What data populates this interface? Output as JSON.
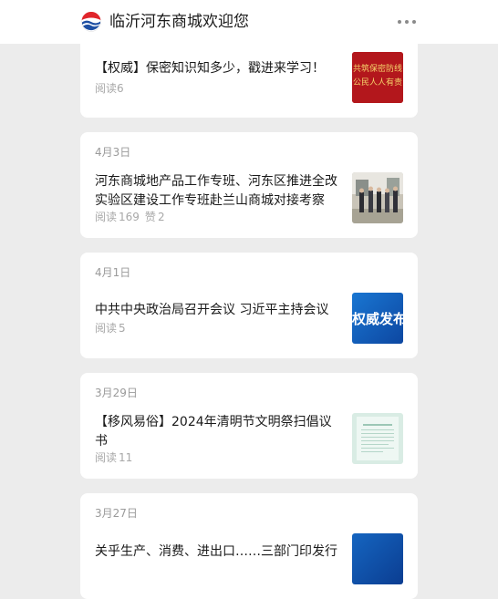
{
  "header": {
    "title": "临沂河东商城欢迎您"
  },
  "articles": [
    {
      "date": "",
      "title": "【权威】保密知识知多少，戳进来学习！",
      "reads_label": "阅读",
      "reads": "6",
      "likes_label": "",
      "likes": "",
      "thumb_text_1": "共筑保密防线",
      "thumb_text_2": "公民人人有责"
    },
    {
      "date": "4月3日",
      "title": "河东商城地产品工作专班、河东区推进全改实验区建设工作专班赴兰山商城对接考察",
      "reads_label": "阅读",
      "reads": "169",
      "likes_label": "赞",
      "likes": "2"
    },
    {
      "date": "4月1日",
      "title": "中共中央政治局召开会议 习近平主持会议",
      "reads_label": "阅读",
      "reads": "5",
      "thumb_text": "权威发布"
    },
    {
      "date": "3月29日",
      "title": "【移风易俗】2024年清明节文明祭扫倡议书",
      "reads_label": "阅读",
      "reads": "11"
    },
    {
      "date": "3月27日",
      "title": "关乎生产、消费、进出口……三部门印发行动方案"
    }
  ],
  "colors": {
    "logo_red": "#e0252b",
    "logo_blue": "#1e4fa3",
    "thumb_red": "#b3171c",
    "thumb_blue": "#1565c0"
  }
}
